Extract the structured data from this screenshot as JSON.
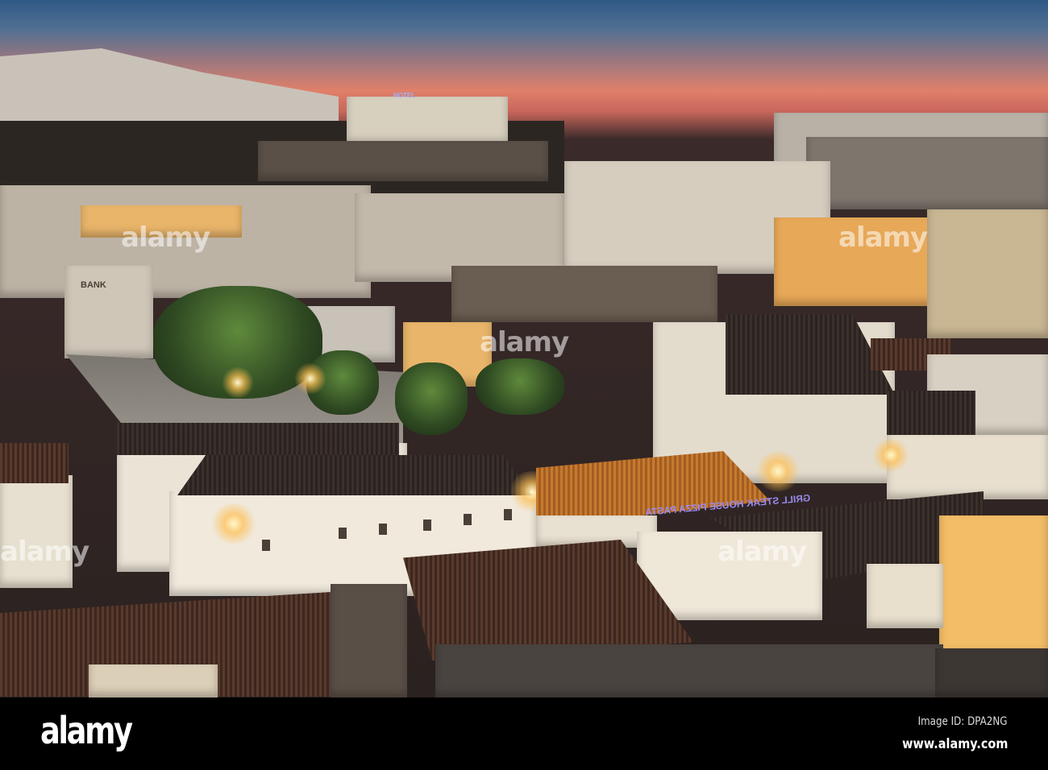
{
  "photo": {
    "subject": "Town at dusk",
    "signs": {
      "bank": "BANK",
      "hotel": "HOTEL",
      "restaurant": "GRILL STEAK HOUSE PIZZA PASTA"
    },
    "watermark": "alamy",
    "colors": {
      "sky_top": "#2f5a86",
      "sky_glow": "#e0806a",
      "lamp": "#ffb84a"
    }
  },
  "footer": {
    "logo": "alamy",
    "image_id": "Image ID: DPA2NG",
    "website": "www.alamy.com"
  }
}
